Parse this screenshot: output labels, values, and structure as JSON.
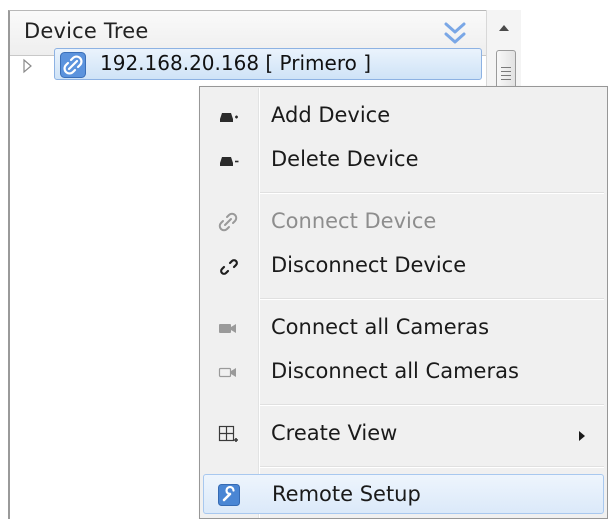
{
  "device_tree": {
    "title": "Device Tree",
    "collapse_icon": "double-chevron-down-icon",
    "nodes": [
      {
        "label": "192.168.20.168 [ Primero ]",
        "icon": "link-icon",
        "expand_icon": "triangle-right-icon",
        "selected": true
      }
    ]
  },
  "scrollbar": {
    "up_icon": "arrow-up-icon",
    "thumb_icon": "grip-lines-icon"
  },
  "context_menu": {
    "items": [
      {
        "label": "Add Device",
        "icon": "device-add-icon",
        "enabled": true
      },
      {
        "label": "Delete Device",
        "icon": "device-remove-icon",
        "enabled": true
      },
      {
        "label": "Connect Device",
        "icon": "link-icon",
        "enabled": false
      },
      {
        "label": "Disconnect Device",
        "icon": "broken-link-icon",
        "enabled": true
      },
      {
        "label": "Connect all Cameras",
        "icon": "camera-filled-icon",
        "enabled": true
      },
      {
        "label": "Disconnect all Cameras",
        "icon": "camera-outline-icon",
        "enabled": true
      },
      {
        "label": "Create View",
        "icon": "grid-add-icon",
        "enabled": true,
        "submenu": true
      },
      {
        "label": "Remote Setup",
        "icon": "wrench-icon",
        "enabled": true,
        "highlighted": true
      }
    ]
  },
  "colors": {
    "selection_fill": "#cfe3f7",
    "selection_border": "#8db2e3",
    "menu_background": "#f0f0f0",
    "disabled_text": "#8d8d8d",
    "icon_blue": "#4a86d4"
  }
}
